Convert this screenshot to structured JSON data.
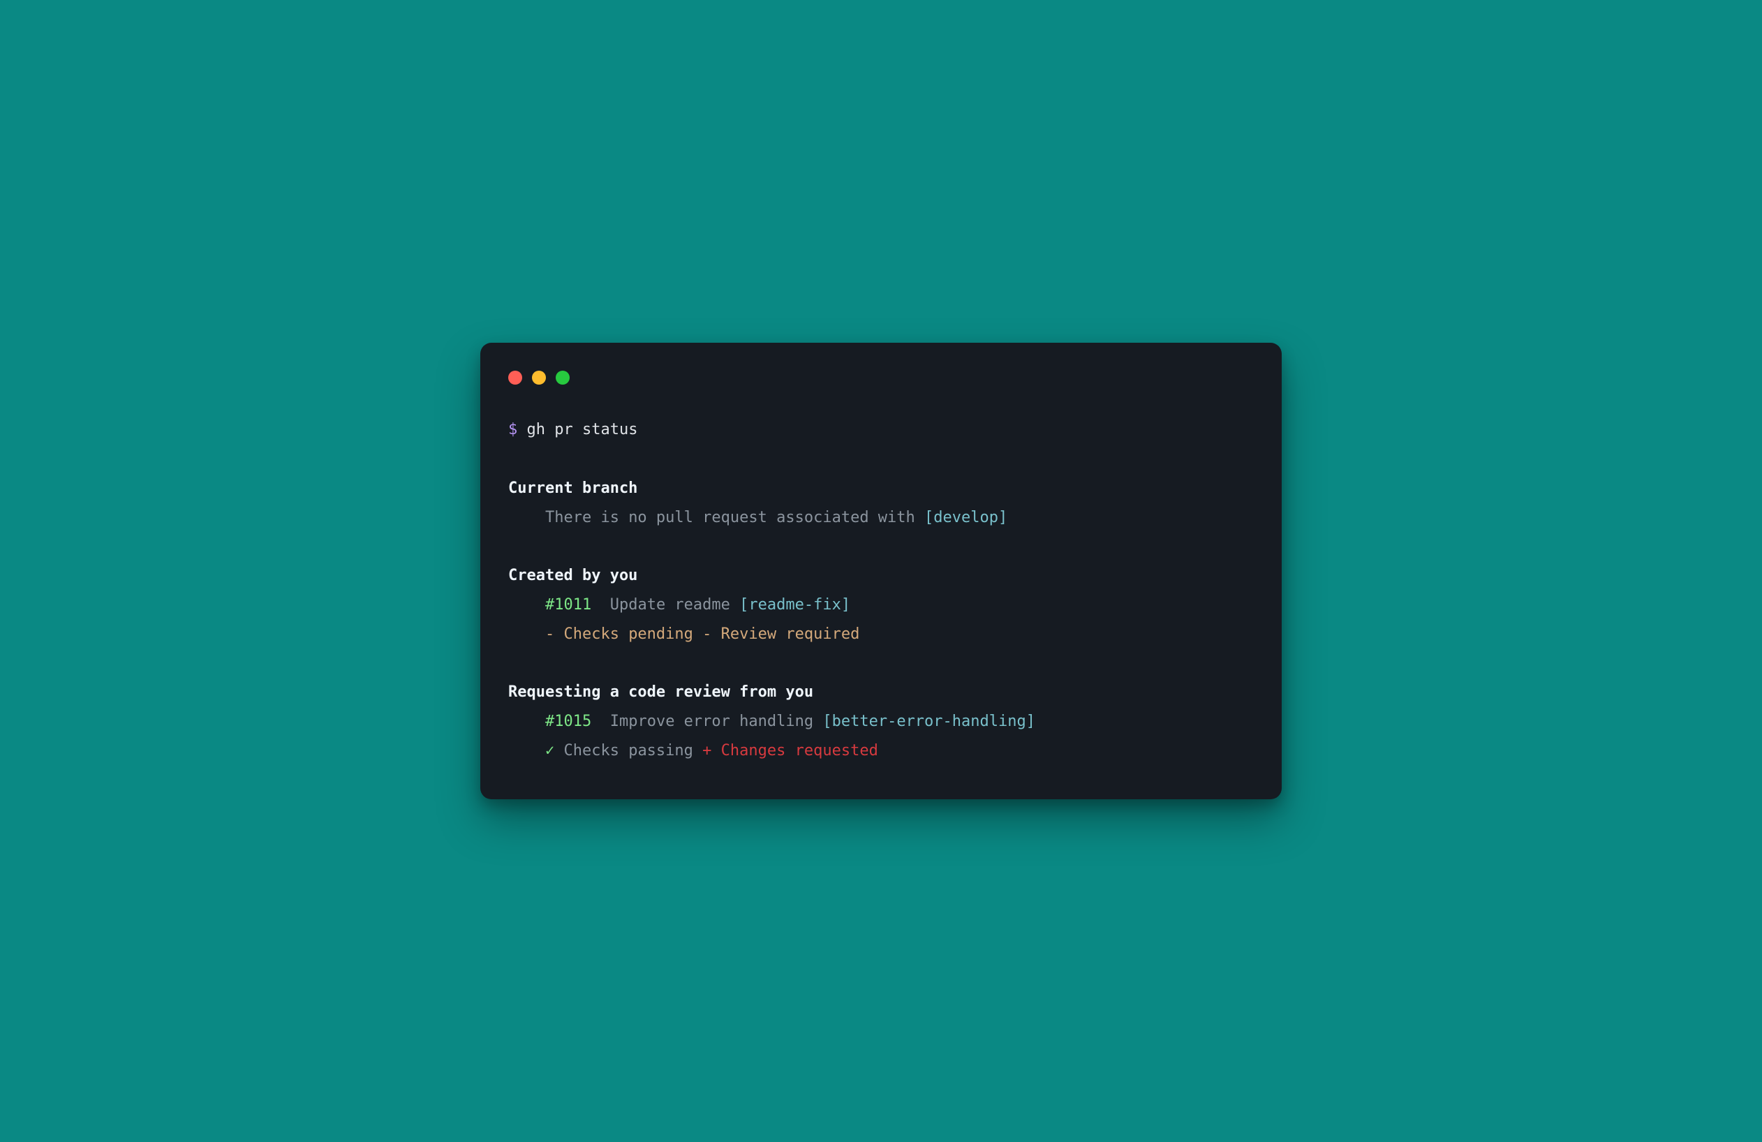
{
  "prompt_symbol": "$",
  "command": "gh pr status",
  "sections": {
    "current_branch": {
      "heading": "Current branch",
      "text_prefix": "There is no pull request associated with ",
      "branch": "[develop]"
    },
    "created_by_you": {
      "heading": "Created by you",
      "pr_number": "#1011",
      "pr_title": "Update readme ",
      "pr_branch": "[readme-fix]",
      "status_line": "- Checks pending - Review required"
    },
    "requesting_review": {
      "heading": "Requesting a code review from you",
      "pr_number": "#1015",
      "pr_title": "Improve error handling ",
      "pr_branch": "[better-error-handling]",
      "checks_mark": "✓",
      "checks_text": " Checks passing ",
      "changes_mark": "+",
      "changes_text": " Changes requested"
    }
  }
}
